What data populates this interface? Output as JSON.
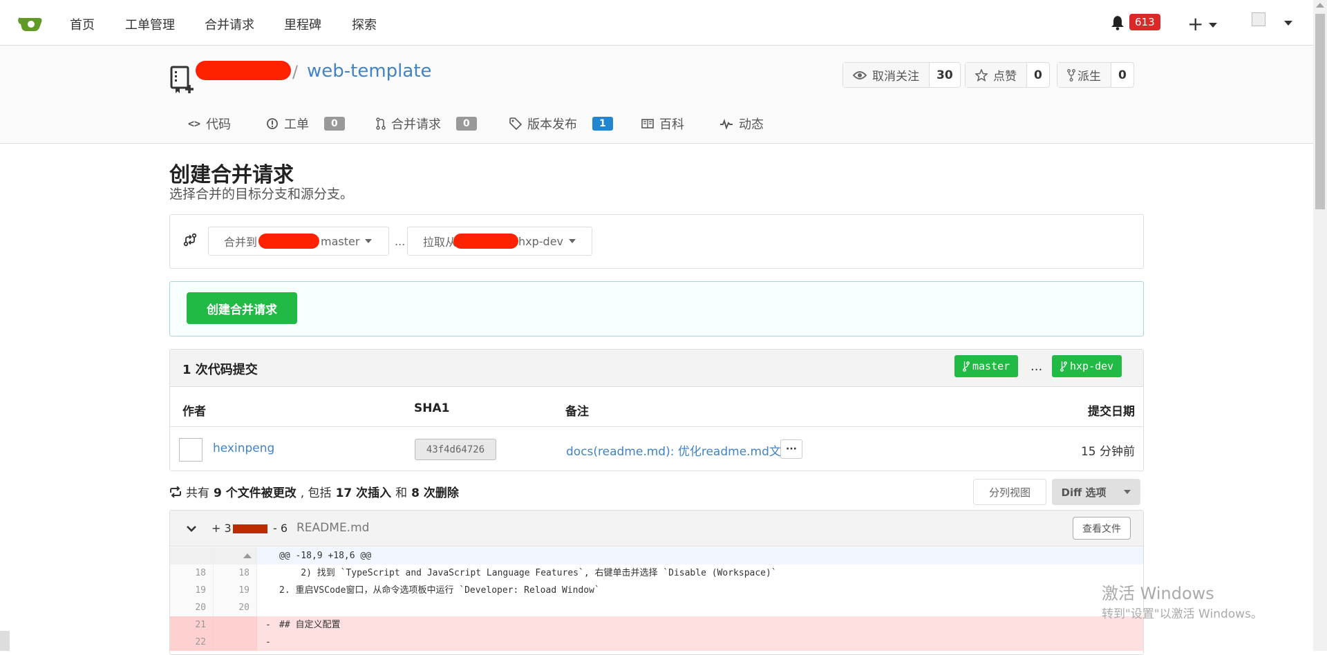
{
  "navbar": {
    "items": [
      "首页",
      "工单管理",
      "合并请求",
      "里程碑",
      "探索"
    ],
    "notifications": "613",
    "plus": "+"
  },
  "repo": {
    "slash": "/",
    "name": "web-template",
    "watch": {
      "label": "取消关注",
      "count": "30"
    },
    "star": {
      "label": "点赞",
      "count": "0"
    },
    "fork": {
      "label": "派生",
      "count": "0"
    }
  },
  "tabs": [
    {
      "label": "代码",
      "icon": "code-icon"
    },
    {
      "label": "工单",
      "badge": "0",
      "icon": "issue-icon"
    },
    {
      "label": "合并请求",
      "badge": "0",
      "icon": "pull-request-icon"
    },
    {
      "label": "版本发布",
      "badge": "1",
      "icon": "tag-icon"
    },
    {
      "label": "百科",
      "icon": "book-icon"
    },
    {
      "label": "动态",
      "icon": "pulse-icon"
    }
  ],
  "page": {
    "title": "创建合并请求",
    "subtitle": "选择合并的目标分支和源分支。",
    "base_prefix": "合并到",
    "base_branch": "master",
    "dots": "...",
    "head_prefix": "拉取从",
    "head_branch": "hxp-dev",
    "create_button": "创建合并请求"
  },
  "commits": {
    "title": "1 次代码提交",
    "base_pill": "master",
    "head_pill": "hxp-dev",
    "pill_dots": "...",
    "columns": {
      "author": "作者",
      "sha": "SHA1",
      "message": "备注",
      "date": "提交日期"
    },
    "row": {
      "author": "hexinpeng",
      "sha": "43f4d64726",
      "message": "docs(readme.md): 优化readme.md文件",
      "more": "···",
      "date": "15 分钟前"
    }
  },
  "diff": {
    "summary": {
      "prefix": "共有",
      "files": "9 个文件被更改",
      "mid": ", 包括",
      "insertions": "17 次插入",
      "and": "和",
      "deletions": "8 次删除"
    },
    "split_button": "分列视图",
    "options_button": "Diff 选项",
    "file": {
      "additions": "+ 3",
      "deletions": "- 6",
      "name": "README.md",
      "view_button": "查看文件"
    },
    "lines": [
      {
        "type": "hunk",
        "old": "",
        "new": "",
        "sign": "",
        "text": "@@ -18,9 +18,6 @@"
      },
      {
        "type": "ctx",
        "old": "18",
        "new": "18",
        "sign": "",
        "text": "    2) 找到 `TypeScript and JavaScript Language Features`, 右键单击并选择 `Disable (Workspace)`"
      },
      {
        "type": "ctx",
        "old": "19",
        "new": "19",
        "sign": "",
        "text": "2. 重启VSCode窗口，从命令选项板中运行 `Developer: Reload Window`"
      },
      {
        "type": "ctx",
        "old": "20",
        "new": "20",
        "sign": "",
        "text": ""
      },
      {
        "type": "del",
        "old": "21",
        "new": "",
        "sign": "-",
        "text": "## 自定义配置"
      },
      {
        "type": "del",
        "old": "22",
        "new": "",
        "sign": "-",
        "text": ""
      }
    ]
  },
  "watermark": {
    "line1": "激活 Windows",
    "line2": "转到\"设置\"以激活 Windows。"
  }
}
